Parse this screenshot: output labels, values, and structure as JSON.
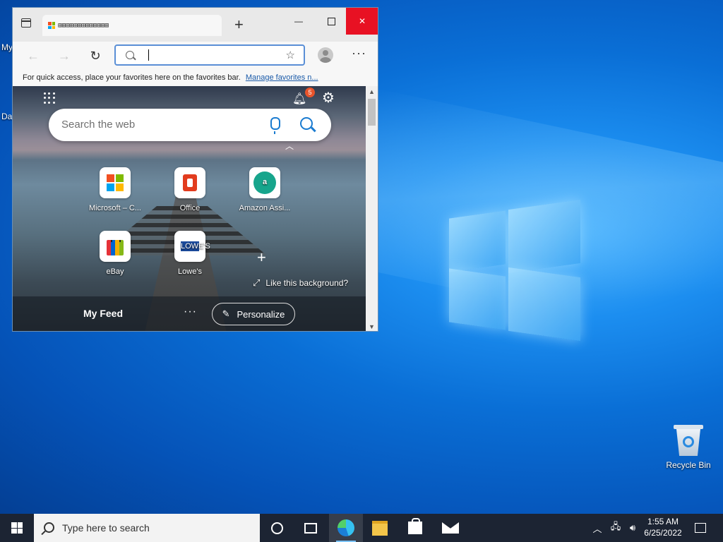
{
  "desktop": {
    "left_labels": [
      "My",
      "Da"
    ],
    "recycle_bin": "Recycle Bin"
  },
  "browser": {
    "tab_title": "⊞⊞⊞⊞⊞⊞⊞⊞⊞⊞⊞⊞⊞",
    "new_tab_glyph": "+",
    "minimize_glyph": "—",
    "close_glyph": "✕",
    "address": {
      "value": "",
      "placeholder": ""
    },
    "favorites_bar": {
      "text": "For quick access, place your favorites here on the favorites bar.",
      "link": "Manage favorites n..."
    },
    "newtab": {
      "notification_count": "5",
      "search_placeholder": "Search the web",
      "tiles": [
        {
          "label": "Microsoft – C...",
          "icon": "microsoft-logo-icon"
        },
        {
          "label": "Office",
          "icon": "office-logo-icon"
        },
        {
          "label": "Amazon Assi...",
          "icon": "amazon-assistant-icon",
          "glyph": "a"
        },
        {
          "label": "eBay",
          "icon": "ebay-bag-icon"
        },
        {
          "label": "Lowe's",
          "icon": "lowes-logo-icon",
          "glyph": "LOWE'S"
        }
      ],
      "like_background": "Like this background?",
      "my_feed": "My Feed",
      "feed_more": "···",
      "personalize": "Personalize"
    }
  },
  "taskbar": {
    "search_placeholder": "Type here to search",
    "time": "1:55 AM",
    "date": "6/25/2022"
  },
  "colors": {
    "ms_red": "#f25022",
    "ms_green": "#7fba00",
    "ms_blue": "#00a4ef",
    "ms_yellow": "#ffb900",
    "close_red": "#e81123",
    "badge": "#e8542b"
  }
}
